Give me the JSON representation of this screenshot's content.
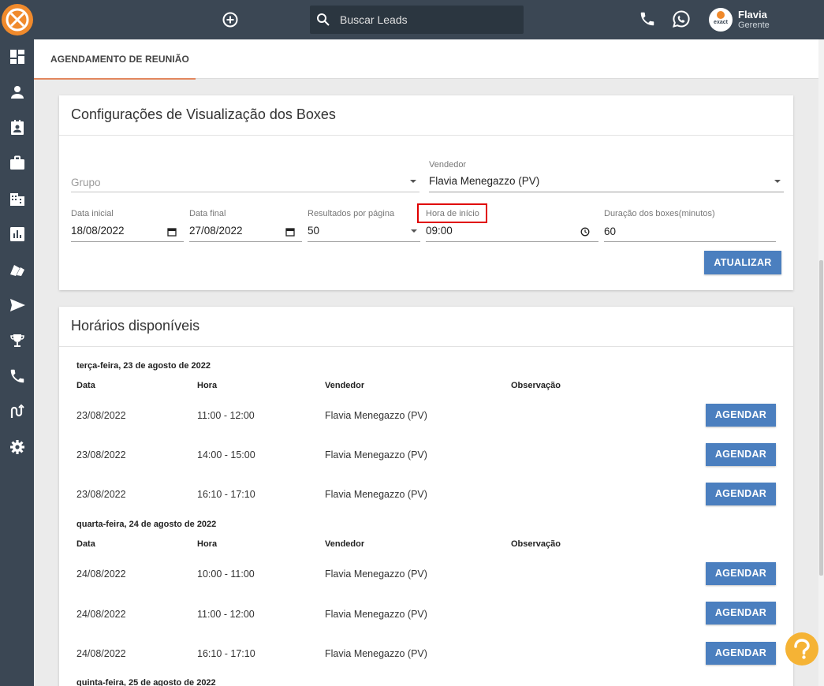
{
  "header": {
    "search_placeholder": "Buscar Leads",
    "user_name": "Flavia",
    "user_role": "Gerente",
    "avatar_brand": "exact"
  },
  "tabs": [
    {
      "label": "AGENDAMENTO DE REUNIÃO",
      "active": true
    }
  ],
  "sidebar_icons": [
    "dashboard-icon",
    "person-icon",
    "contact-card-icon",
    "briefcase-icon",
    "building-icon",
    "bar-chart-icon",
    "book-icon",
    "send-icon",
    "trophy-icon",
    "phone-icon",
    "route-icon",
    "gear-icon"
  ],
  "config": {
    "title": "Configurações de Visualização dos Boxes",
    "grupo_placeholder": "Grupo",
    "vendedor_label": "Vendedor",
    "vendedor_value": "Flavia Menegazzo (PV)",
    "data_inicial_label": "Data inicial",
    "data_inicial_value": "18/08/2022",
    "data_final_label": "Data final",
    "data_final_value": "27/08/2022",
    "resultados_label": "Resultados por página",
    "resultados_value": "50",
    "hora_label": "Hora de início",
    "hora_value": "09:00",
    "duracao_label": "Duração dos boxes(minutos)",
    "duracao_value": "60",
    "atualizar_label": "ATUALIZAR"
  },
  "horarios": {
    "title": "Horários disponíveis",
    "headers": {
      "data": "Data",
      "hora": "Hora",
      "vendedor": "Vendedor",
      "observacao": "Observação"
    },
    "agendar_label": "AGENDAR",
    "days": [
      {
        "title": "terça-feira, 23 de agosto de 2022",
        "slots": [
          {
            "data": "23/08/2022",
            "hora": "11:00 - 12:00",
            "vendedor": "Flavia Menegazzo (PV)",
            "observacao": ""
          },
          {
            "data": "23/08/2022",
            "hora": "14:00 - 15:00",
            "vendedor": "Flavia Menegazzo (PV)",
            "observacao": ""
          },
          {
            "data": "23/08/2022",
            "hora": "16:10 - 17:10",
            "vendedor": "Flavia Menegazzo (PV)",
            "observacao": ""
          }
        ]
      },
      {
        "title": "quarta-feira, 24 de agosto de 2022",
        "slots": [
          {
            "data": "24/08/2022",
            "hora": "10:00 - 11:00",
            "vendedor": "Flavia Menegazzo (PV)",
            "observacao": ""
          },
          {
            "data": "24/08/2022",
            "hora": "11:00 - 12:00",
            "vendedor": "Flavia Menegazzo (PV)",
            "observacao": ""
          },
          {
            "data": "24/08/2022",
            "hora": "16:10 - 17:10",
            "vendedor": "Flavia Menegazzo (PV)",
            "observacao": ""
          }
        ]
      },
      {
        "title": "quinta-feira, 25 de agosto de 2022",
        "slots": []
      }
    ]
  },
  "colors": {
    "topbar": "#3b4754",
    "brand_orange": "#f08a2c",
    "button_blue": "#4b7fbf",
    "highlight": "#e00000",
    "help_yellow": "#f5b335"
  }
}
